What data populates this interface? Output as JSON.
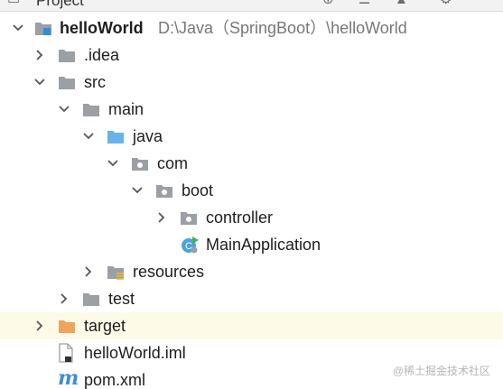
{
  "header": {
    "title": "Project"
  },
  "tree": {
    "root": {
      "label": "helloWorld",
      "path": "D:\\Java（SpringBoot）\\helloWorld"
    },
    "idea": {
      "label": ".idea"
    },
    "src": {
      "label": "src"
    },
    "main": {
      "label": "main"
    },
    "java": {
      "label": "java"
    },
    "com": {
      "label": "com"
    },
    "boot": {
      "label": "boot"
    },
    "controller": {
      "label": "controller"
    },
    "main_application": {
      "label": "MainApplication"
    },
    "resources": {
      "label": "resources"
    },
    "test": {
      "label": "test"
    },
    "target": {
      "label": "target"
    },
    "iml": {
      "label": "helloWorld.iml"
    },
    "pom": {
      "label": "pom.xml"
    }
  },
  "watermark": "@稀土掘金技术社区",
  "colors": {
    "folder_gray": "#9aa0a6",
    "folder_blue": "#67b4e8",
    "folder_orange": "#f0a35a",
    "row_highlight": "#fdfbe7",
    "path_text": "#777777"
  }
}
